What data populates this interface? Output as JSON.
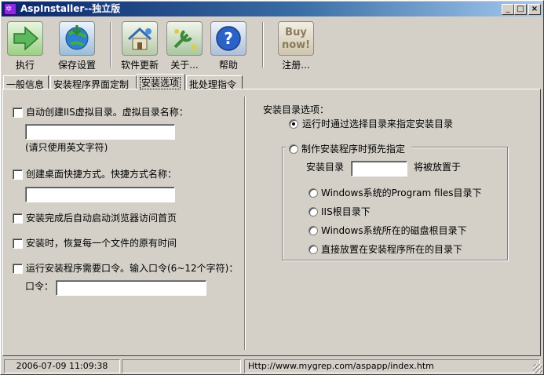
{
  "window": {
    "title": "AspInstaller--独立版",
    "min": "_",
    "max": "□",
    "close": "×"
  },
  "toolbar": {
    "run": "执行",
    "save": "保存设置",
    "update": "软件更新",
    "about": "关于...",
    "help": "帮助",
    "register": "注册...",
    "buy_line1": "Buy",
    "buy_line2": "now!"
  },
  "tabs": [
    "一般信息",
    "安装程序界面定制",
    "安装选项",
    "批处理指令"
  ],
  "active_tab": 2,
  "left": {
    "opt1": "自动创建IIS虚拟目录。虚拟目录名称：",
    "opt1_hint": "(请只使用英文字符)",
    "opt2": "创建桌面快捷方式。快捷方式名称：",
    "opt3": "安装完成后自动启动浏览器访问首页",
    "opt4": "安装时，恢复每一个文件的原有时间",
    "opt5": "运行安装程序需要口令。输入口令(6~12个字符)：",
    "pwd_label": "口令："
  },
  "right": {
    "header": "安装目录选项：",
    "radio_runtime": "运行时通过选择目录来指定安装目录",
    "radio_preset": "制作安装程序时预先指定",
    "dir_label": "安装目录",
    "dir_suffix": "将被放置于",
    "sub1": "Windows系统的Program files目录下",
    "sub2": "IIS根目录下",
    "sub3": "Windows系统所在的磁盘根目录下",
    "sub4": "直接放置在安装程序所在的目录下"
  },
  "status": {
    "datetime": "2006-07-09 11:09:38",
    "middle": "",
    "url": "Http://www.mygrep.com/aspapp/index.htm"
  },
  "colors": {
    "title_start": "#0a246a",
    "title_end": "#a6caf0",
    "face": "#d4d0c8"
  }
}
